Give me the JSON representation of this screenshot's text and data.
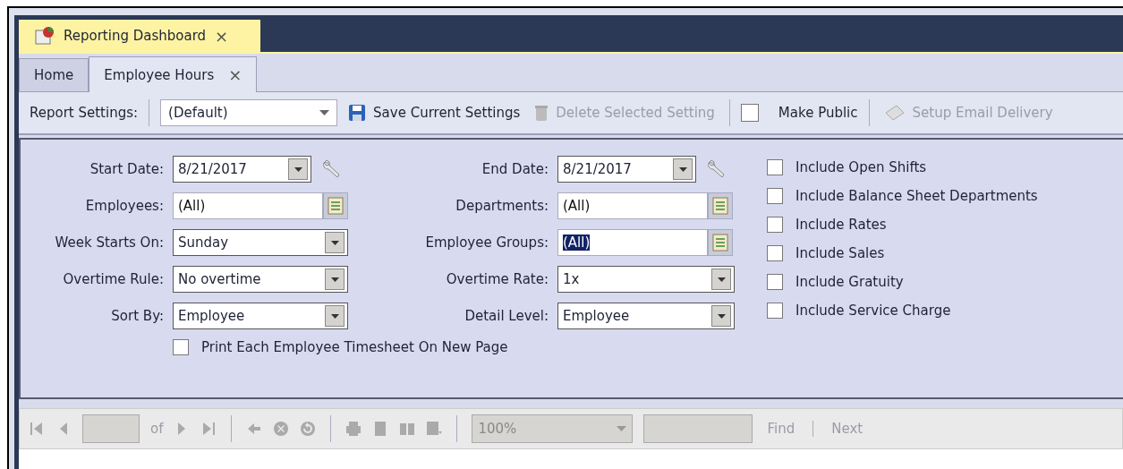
{
  "document_tab": {
    "label": "Reporting Dashboard",
    "close": "×"
  },
  "tabs": [
    {
      "label": "Home",
      "selected": false
    },
    {
      "label": "Employee Hours",
      "selected": true,
      "close": "×"
    }
  ],
  "toolbar": {
    "settings_label": "Report Settings:",
    "settings_value": "(Default)",
    "items": [
      {
        "kind": "save",
        "label": "Save Current Settings",
        "disabled": false
      },
      {
        "kind": "delete",
        "label": "Delete Selected Setting",
        "disabled": true
      },
      {
        "kind": "checkbox",
        "label": "Make Public",
        "checked": false
      },
      {
        "kind": "email",
        "label": "Setup Email Delivery",
        "disabled": true
      }
    ]
  },
  "form": {
    "fields": [
      {
        "kind": "date",
        "label": "Start Date:",
        "value": "8/21/2017"
      },
      {
        "kind": "date",
        "label": "End Date:",
        "value": "8/21/2017"
      },
      {
        "kind": "picker",
        "label": "Employees:",
        "value": "(All)",
        "highlighted": false
      },
      {
        "kind": "picker",
        "label": "Departments:",
        "value": "(All)",
        "highlighted": false
      },
      {
        "kind": "select",
        "label": "Week Starts On:",
        "value": "Sunday"
      },
      {
        "kind": "picker",
        "label": "Employee Groups:",
        "value": "(All)",
        "highlighted": true
      },
      {
        "kind": "select",
        "label": "Overtime Rule:",
        "value": "No overtime"
      },
      {
        "kind": "select",
        "label": "Overtime Rate:",
        "value": "1x"
      },
      {
        "kind": "select",
        "label": "Sort By:",
        "value": "Employee"
      },
      {
        "kind": "select",
        "label": "Detail Level:",
        "value": "Employee"
      }
    ],
    "print_option": {
      "label": "Print Each Employee Timesheet On New Page",
      "checked": false
    },
    "options": [
      {
        "label": "Include Open Shifts",
        "checked": false
      },
      {
        "label": "Include Balance Sheet Departments",
        "checked": false
      },
      {
        "label": "Include Rates",
        "checked": false
      },
      {
        "label": "Include Sales",
        "checked": false
      },
      {
        "label": "Include Gratuity",
        "checked": false
      },
      {
        "label": "Include Service Charge",
        "checked": false
      }
    ]
  },
  "viewer_toolbar": {
    "of": "of",
    "zoom": "100%",
    "find": "Find",
    "next": "Next"
  }
}
